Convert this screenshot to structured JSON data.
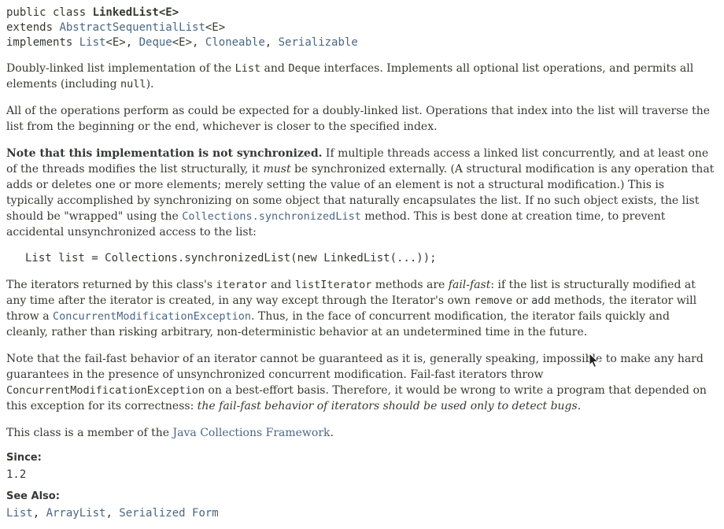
{
  "signature": {
    "line1_prefix": "public class ",
    "class_name": "LinkedList<E>",
    "line2_prefix": "extends ",
    "superclass": "AbstractSequentialList",
    "superclass_generic": "<E>",
    "line3_prefix": "implements ",
    "iface1": "List",
    "iface1_generic": "<E>",
    "sep1": ", ",
    "iface2": "Deque",
    "iface2_generic": "<E>",
    "sep2": ", ",
    "iface3": "Cloneable",
    "sep3": ", ",
    "iface4": "Serializable"
  },
  "p1": {
    "t1": "Doubly-linked list implementation of the ",
    "c1": "List",
    "t2": " and ",
    "c2": "Deque",
    "t3": " interfaces. Implements all optional list operations, and permits all elements (including ",
    "c3": "null",
    "t4": ")."
  },
  "p2": {
    "text": "All of the operations perform as could be expected for a doubly-linked list. Operations that index into the list will traverse the list from the beginning or the end, whichever is closer to the specified index."
  },
  "p3": {
    "bold": "Note that this implementation is not synchronized.",
    "t1": " If multiple threads access a linked list concurrently, and at least one of the threads modifies the list structurally, it ",
    "em": "must",
    "t2": " be synchronized externally. (A structural modification is any operation that adds or deletes one or more elements; merely setting the value of an element is not a structural modification.) This is typically accomplished by synchronizing on some object that naturally encapsulates the list. If no such object exists, the list should be \"wrapped\" using the ",
    "link": "Collections.synchronizedList",
    "t3": " method. This is best done at creation time, to prevent accidental unsynchronized access to the list:"
  },
  "code": "List list = Collections.synchronizedList(new LinkedList(...));",
  "p4": {
    "t1": "The iterators returned by this class's ",
    "c1": "iterator",
    "t2": " and ",
    "c2": "listIterator",
    "t3": " methods are ",
    "em": "fail-fast",
    "t4": ": if the list is structurally modified at any time after the iterator is created, in any way except through the Iterator's own ",
    "c3": "remove",
    "t5": " or ",
    "c4": "add",
    "t6": " methods, the iterator will throw a ",
    "link": "ConcurrentModificationException",
    "t7": ". Thus, in the face of concurrent modification, the iterator fails quickly and cleanly, rather than risking arbitrary, non-deterministic behavior at an undetermined time in the future."
  },
  "p5": {
    "t1": "Note that the fail-fast behavior of an iterator cannot be guaranteed as it is, generally speaking, impossible to make any hard guarantees in the presence of unsynchronized concurrent modification. Fail-fast iterators throw ",
    "c1": "ConcurrentModificationException",
    "t2": " on a best-effort basis. Therefore, it would be wrong to write a program that depended on this exception for its correctness: ",
    "em": "the fail-fast behavior of iterators should be used only to detect bugs."
  },
  "p6": {
    "t1": "This class is a member of the ",
    "link": "Java Collections Framework",
    "t2": "."
  },
  "since": {
    "label": "Since:",
    "value": "1.2"
  },
  "see_also": {
    "label": "See Also:",
    "links": [
      "List",
      "ArrayList",
      "Serialized Form"
    ],
    "sep": ", "
  },
  "colors": {
    "text": "#353833",
    "link": "#4a6782"
  }
}
